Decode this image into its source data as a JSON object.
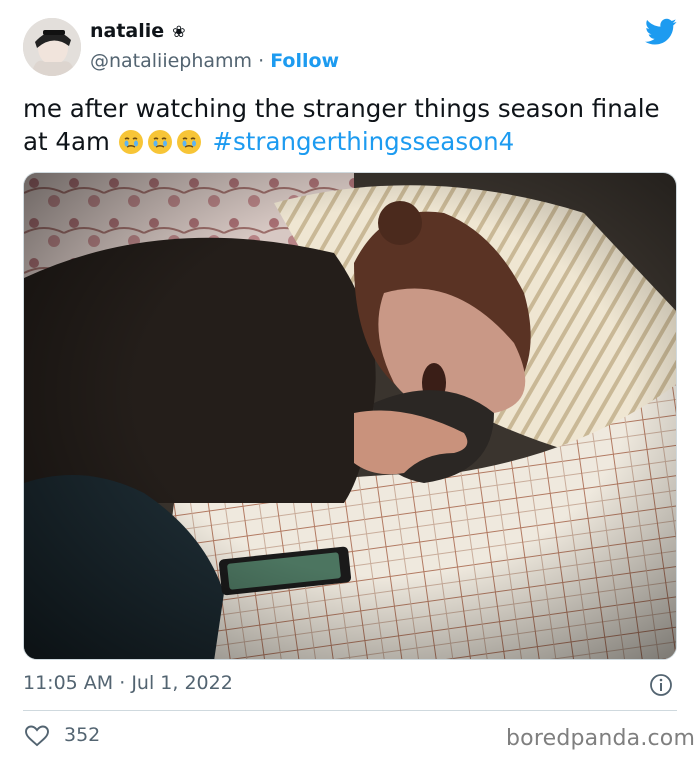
{
  "author": {
    "display_name": "natalie",
    "name_symbol": "❀",
    "handle": "@nataliiephamm",
    "separator": "·",
    "follow_label": "Follow"
  },
  "tweet": {
    "text": "me after watching the stranger things season finale at 4am",
    "emoji_count": 3,
    "emoji_name": "face-holding-back-tears",
    "hashtag": "#strangerthingsseason4"
  },
  "media": {
    "image_description_name": "girl-crying-in-bed-photo"
  },
  "meta": {
    "time": "11:05 AM",
    "separator": "·",
    "date": "Jul 1, 2022"
  },
  "engagement": {
    "likes": "352"
  },
  "watermark": "boredpanda.com",
  "colors": {
    "accent": "#1d9bf0",
    "text": "#0f1419",
    "secondary": "#536471",
    "divider": "#cfd9de"
  }
}
